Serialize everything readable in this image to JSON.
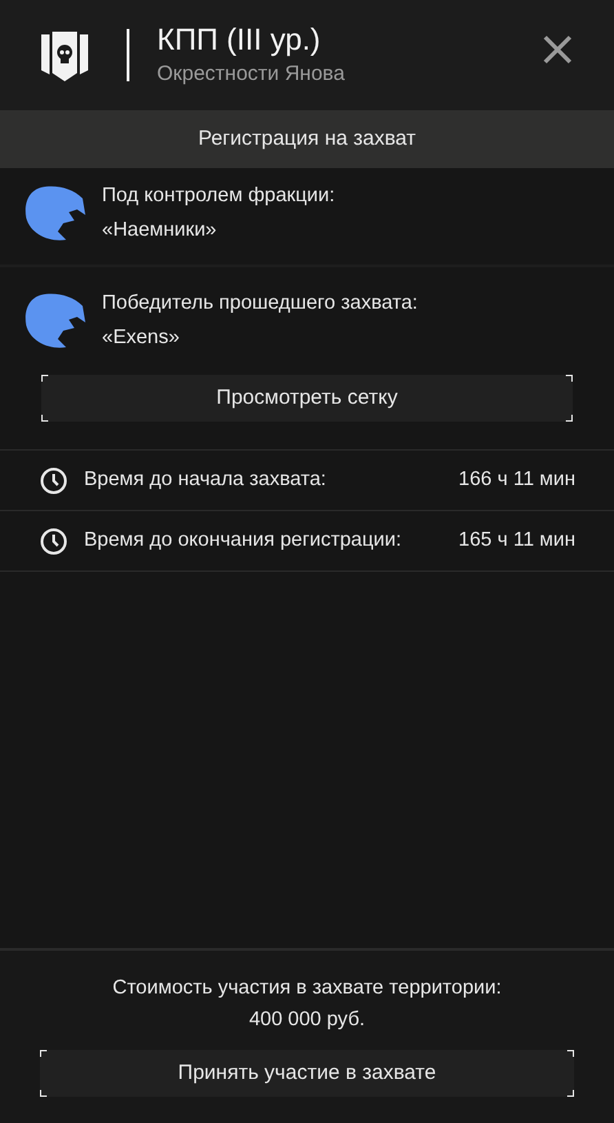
{
  "header": {
    "title": "КПП (III ур.)",
    "subtitle": "Окрестности Янова"
  },
  "tabs": [
    {
      "label": "Регистрация на захват",
      "selected": true
    }
  ],
  "factions": [
    {
      "label": "Под контролем фракции:",
      "name": "«Наемники»"
    },
    {
      "label": "Победитель прошедшего захвата:",
      "name": "«Exens»"
    }
  ],
  "view_grid_button": "Просмотреть сетку",
  "timers": [
    {
      "label": "Время до начала захвата:",
      "value": "166 ч 11 мин"
    },
    {
      "label": "Время до окончания регистрации:",
      "value": "165 ч 11 мин"
    }
  ],
  "footer": {
    "cost_label": "Стоимость участия в захвате территории:",
    "cost": "400 000 руб.",
    "button": "Принять участие в захвате"
  }
}
